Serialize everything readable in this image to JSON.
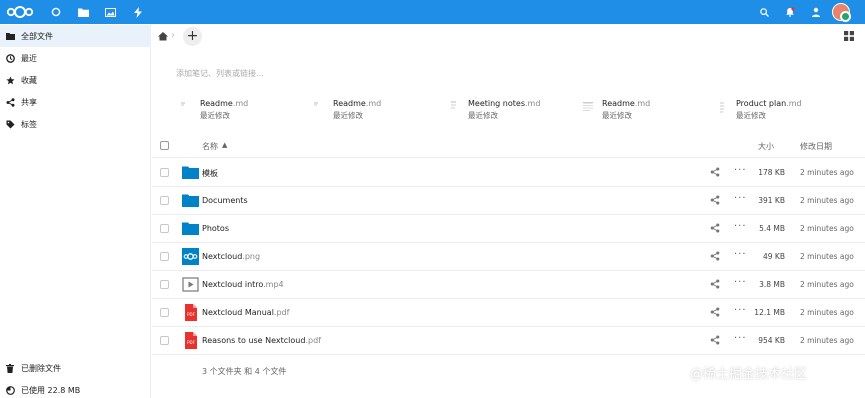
{
  "header": {
    "apps": [
      "dashboard-icon",
      "files-icon",
      "photos-icon",
      "activity-icon"
    ],
    "right_icons": [
      "search-icon",
      "notifications-icon",
      "contacts-icon"
    ],
    "accent_color": "#1f8ee6"
  },
  "sidebar": {
    "items": [
      {
        "label": "全部文件",
        "icon": "folder-icon"
      },
      {
        "label": "最近",
        "icon": "clock-icon"
      },
      {
        "label": "收藏",
        "icon": "star-icon"
      },
      {
        "label": "共享",
        "icon": "share-icon"
      },
      {
        "label": "标签",
        "icon": "tag-icon"
      }
    ],
    "bottom": [
      {
        "label": "已删除文件",
        "icon": "trash-icon"
      },
      {
        "label": "已使用 22.8 MB",
        "icon": "quota-pie-icon"
      }
    ]
  },
  "main": {
    "description_placeholder": "添加笔记、列表或链接...",
    "recent": [
      {
        "name": "Readme",
        "ext": ".md",
        "sub": "最近修改"
      },
      {
        "name": "Readme",
        "ext": ".md",
        "sub": "最近修改"
      },
      {
        "name": "Meeting notes",
        "ext": ".md",
        "sub": "最近修改"
      },
      {
        "name": "Readme",
        "ext": ".md",
        "sub": "最近修改"
      },
      {
        "name": "Product plan",
        "ext": ".md",
        "sub": "最近修改"
      }
    ],
    "table": {
      "col_name": "名称",
      "sort_indicator": "▲",
      "col_size": "大小",
      "col_modified": "修改日期",
      "rows": [
        {
          "name": "模板",
          "ext": "",
          "type": "folder",
          "size": "178 KB",
          "modified": "2 minutes ago"
        },
        {
          "name": "Documents",
          "ext": "",
          "type": "folder",
          "size": "391 KB",
          "modified": "2 minutes ago"
        },
        {
          "name": "Photos",
          "ext": "",
          "type": "folder",
          "size": "5.4 MB",
          "modified": "2 minutes ago"
        },
        {
          "name": "Nextcloud",
          "ext": ".png",
          "type": "image",
          "size": "49 KB",
          "modified": "2 minutes ago"
        },
        {
          "name": "Nextcloud intro",
          "ext": ".mp4",
          "type": "video",
          "size": "3.8 MB",
          "modified": "2 minutes ago"
        },
        {
          "name": "Nextcloud Manual",
          "ext": ".pdf",
          "type": "pdf",
          "size": "12.1 MB",
          "modified": "2 minutes ago"
        },
        {
          "name": "Reasons to use Nextcloud",
          "ext": ".pdf",
          "type": "pdf",
          "size": "954 KB",
          "modified": "2 minutes ago"
        }
      ],
      "more_label": "···"
    },
    "summary": "3 个文件夹 和 4 个文件"
  },
  "watermark": "@稀土掘金技术社区"
}
